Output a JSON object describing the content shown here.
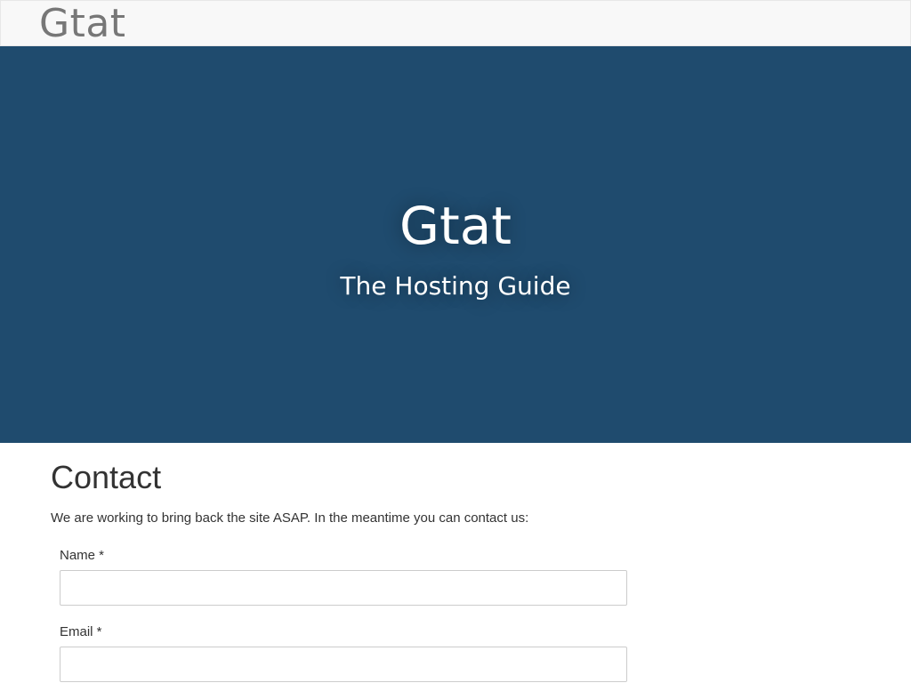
{
  "navbar": {
    "brand": "Gtat"
  },
  "hero": {
    "title": "Gtat",
    "subtitle": "The Hosting Guide",
    "background_color": "#1f4b6e"
  },
  "contact": {
    "heading": "Contact",
    "intro": "We are working to bring back the site ASAP. In the meantime you can contact us:",
    "fields": [
      {
        "label": "Name *",
        "value": "",
        "placeholder": ""
      },
      {
        "label": "Email *",
        "value": "",
        "placeholder": ""
      }
    ]
  }
}
